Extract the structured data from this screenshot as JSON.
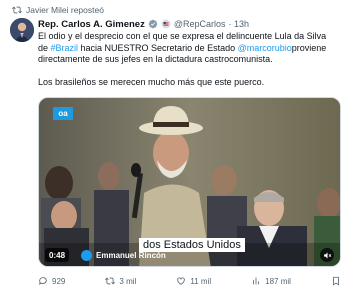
{
  "repost": {
    "text": "Javier Milei reposteó"
  },
  "author": {
    "name": "Rep. Carlos A. Gimenez",
    "handle": "@RepCarlos",
    "time": "· 13h"
  },
  "tweet": {
    "p1_a": "El odio y el desprecio con el que se expresa el delincuente Lula da Silva de ",
    "hashtag": "#Brazil",
    "p1_b": " hacia NUESTRO Secretario de Estado ",
    "mention": "@marcorubio",
    "p1_c": "proviene directamente de sus jefes en la dictadura castrocomunista.",
    "p2": "Los brasileños se merecen mucho más que este puerco."
  },
  "media": {
    "logo": "oa",
    "subtitle": "dos Estados Unidos",
    "duration": "0:48",
    "reporter": "Emmanuel Rincón"
  },
  "actions": {
    "replies": "929",
    "reposts": "3 mil",
    "likes": "11 mil",
    "views": "187 mil"
  },
  "colors": {
    "accent": "#1d9bf0",
    "muted": "#536471",
    "text": "#0f1419"
  }
}
